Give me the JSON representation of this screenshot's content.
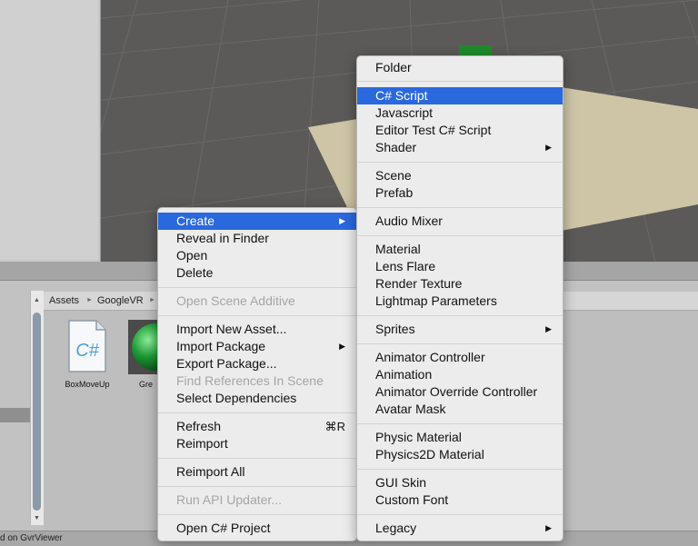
{
  "breadcrumb": {
    "segments": [
      "Assets",
      "GoogleVR"
    ],
    "separator": "►"
  },
  "assets": [
    {
      "name": "BoxMoveUp",
      "type_icon": "csharp-script-icon",
      "icon_text": "C#"
    },
    {
      "name": "Gre",
      "type_icon": "material-sphere-icon"
    }
  ],
  "status_bar": {
    "text": "d on GvrViewer"
  },
  "context_menu": {
    "items": [
      {
        "label": "Create",
        "selected": true,
        "submenu": true
      },
      {
        "label": "Reveal in Finder"
      },
      {
        "label": "Open"
      },
      {
        "label": "Delete"
      },
      {
        "label": "Open Scene Additive",
        "disabled": true
      },
      {
        "label": "Import New Asset..."
      },
      {
        "label": "Import Package",
        "submenu": true
      },
      {
        "label": "Export Package..."
      },
      {
        "label": "Find References In Scene",
        "disabled": true
      },
      {
        "label": "Select Dependencies"
      },
      {
        "label": "Refresh",
        "shortcut": "⌘R"
      },
      {
        "label": "Reimport"
      },
      {
        "label": "Reimport All"
      },
      {
        "label": "Run API Updater...",
        "disabled": true
      },
      {
        "label": "Open C# Project"
      }
    ]
  },
  "create_submenu": {
    "items": [
      {
        "label": "Folder"
      },
      {
        "label": "C# Script",
        "selected": true
      },
      {
        "label": "Javascript"
      },
      {
        "label": "Editor Test C# Script"
      },
      {
        "label": "Shader",
        "submenu": true
      },
      {
        "label": "Scene"
      },
      {
        "label": "Prefab"
      },
      {
        "label": "Audio Mixer"
      },
      {
        "label": "Material"
      },
      {
        "label": "Lens Flare"
      },
      {
        "label": "Render Texture"
      },
      {
        "label": "Lightmap Parameters"
      },
      {
        "label": "Sprites",
        "submenu": true
      },
      {
        "label": "Animator Controller"
      },
      {
        "label": "Animation"
      },
      {
        "label": "Animator Override Controller"
      },
      {
        "label": "Avatar Mask"
      },
      {
        "label": "Physic Material"
      },
      {
        "label": "Physics2D Material"
      },
      {
        "label": "GUI Skin"
      },
      {
        "label": "Custom Font"
      },
      {
        "label": "Legacy",
        "submenu": true
      }
    ]
  },
  "colors": {
    "selection": "#2a68dd",
    "menu_bg": "#ececec",
    "scene_bg": "#5b5a58"
  }
}
